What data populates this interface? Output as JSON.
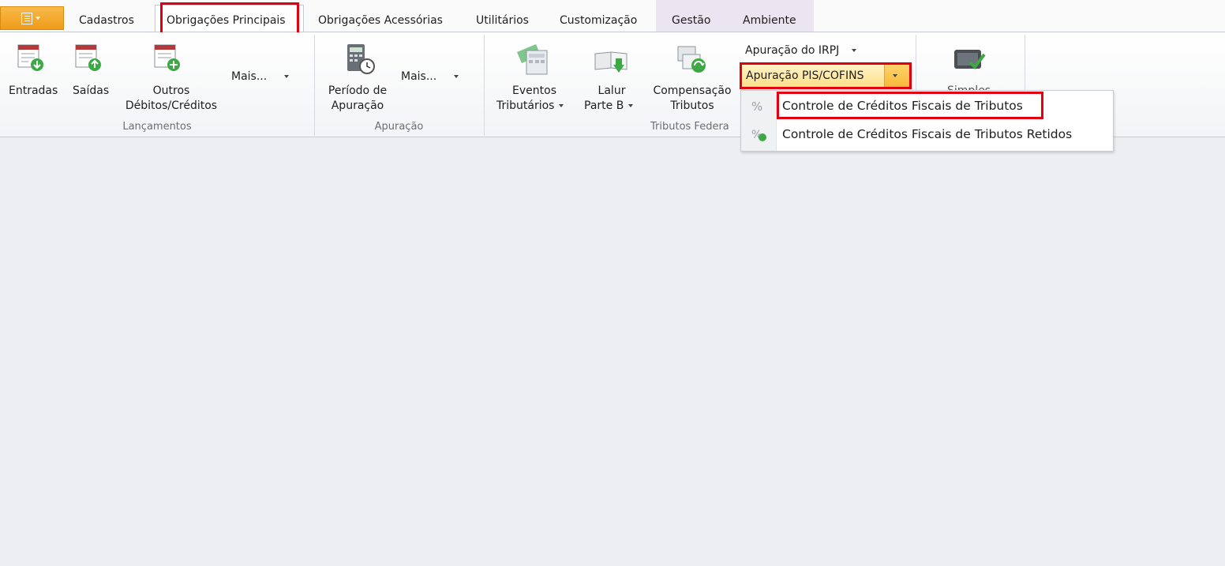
{
  "tabs": [
    {
      "label": "Cadastros"
    },
    {
      "label": "Obrigações Principais"
    },
    {
      "label": "Obrigações Acessórias"
    },
    {
      "label": "Utilitários"
    },
    {
      "label": "Customização"
    },
    {
      "label": "Gestão"
    },
    {
      "label": "Ambiente"
    }
  ],
  "active_tab": "Obrigações Principais",
  "groups": {
    "lancamentos": {
      "label": "Lançamentos",
      "entradas": "Entradas",
      "saidas": "Saídas",
      "outros_1": "Outros",
      "outros_2": "Débitos/Créditos",
      "mais": "Mais..."
    },
    "apuracao": {
      "label": "Apuração",
      "periodo_1": "Período de",
      "periodo_2": "Apuração",
      "mais": "Mais..."
    },
    "tributos": {
      "label": "Tributos Federa",
      "eventos_1": "Eventos",
      "eventos_2": "Tributários",
      "lalur_1": "Lalur",
      "lalur_2": "Parte B",
      "comp_1": "Compensação",
      "comp_2": "Tributos",
      "irpj": "Apuração do IRPJ",
      "piscofins": "Apuração PIS/COFINS"
    },
    "simples": {
      "label_partial": "Simples"
    }
  },
  "dropdown_menu": {
    "items": [
      {
        "label": "Controle de Créditos Fiscais de Tributos"
      },
      {
        "label": "Controle de Créditos Fiscais de Tributos Retidos"
      }
    ]
  },
  "colors": {
    "highlight": "#e0000f",
    "app_button": "#f5a623"
  }
}
